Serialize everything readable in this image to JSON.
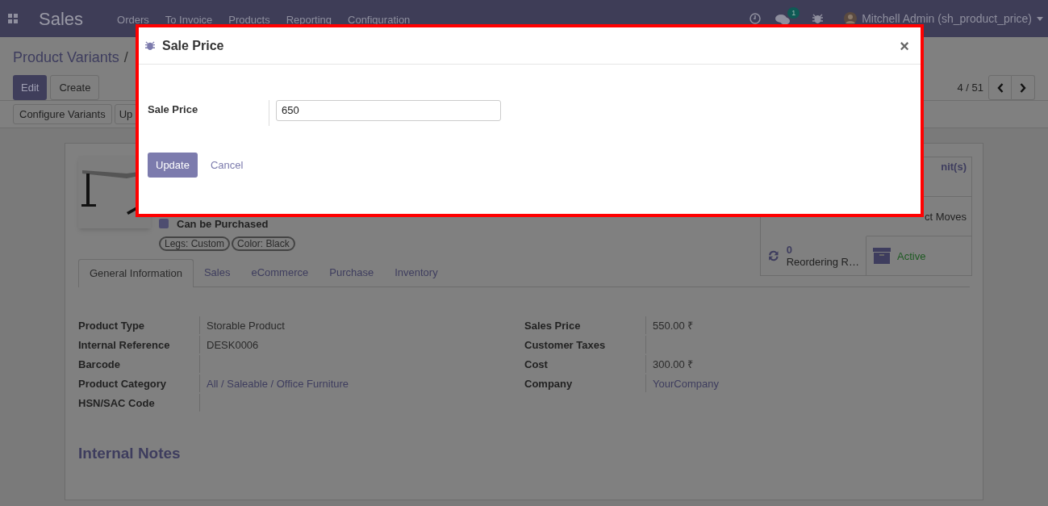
{
  "navbar": {
    "app_title": "Sales",
    "menu": [
      "Orders",
      "To Invoice",
      "Products",
      "Reporting",
      "Configuration"
    ],
    "chat_badge": "1",
    "user": "Mitchell Admin (sh_product_price)"
  },
  "control_panel": {
    "breadcrumb": "Product Variants",
    "separator": "/",
    "buttons": [
      "Edit",
      "Create"
    ],
    "pager": "4 / 51",
    "actions": [
      "Configure Variants",
      "Up"
    ]
  },
  "product": {
    "checkboxes": [
      {
        "label": "Can be Purchased",
        "checked": true
      }
    ],
    "tags": [
      "Legs: Custom",
      "Color: Black"
    ],
    "stat_buttons": [
      {
        "kind": "text",
        "label": "nit(s)"
      },
      {
        "kind": "text",
        "label": "ct Moves"
      },
      {
        "kind": "refresh",
        "value": "0",
        "label": "Reordering R…"
      },
      {
        "kind": "archive",
        "label": "Active"
      }
    ]
  },
  "tabs": [
    {
      "label": "General Information",
      "selected": true
    },
    {
      "label": "Sales",
      "selected": false
    },
    {
      "label": "eCommerce",
      "selected": false
    },
    {
      "label": "Purchase",
      "selected": false
    },
    {
      "label": "Inventory",
      "selected": false
    }
  ],
  "fields_left": [
    {
      "label": "Product Type",
      "value": "Storable Product"
    },
    {
      "label": "Internal Reference",
      "value": "DESK0006"
    },
    {
      "label": "Barcode"
    },
    {
      "label": "Product Category",
      "value": "All / Saleable / Office Furniture",
      "kind": "link"
    },
    {
      "label": "HSN/SAC Code"
    }
  ],
  "fields_right": [
    {
      "label": "Sales Price",
      "value": "550.00 ₹"
    },
    {
      "label": "Customer Taxes"
    },
    {
      "label": "Cost",
      "value": "300.00 ₹"
    },
    {
      "label": "Company",
      "value": "YourCompany",
      "kind": "link"
    }
  ],
  "notes_title": "Internal Notes",
  "dialog": {
    "title": "Sale Price",
    "field_label": "Sale Price",
    "field_value": "650",
    "buttons": [
      "Update",
      "Cancel"
    ],
    "close": "×"
  }
}
